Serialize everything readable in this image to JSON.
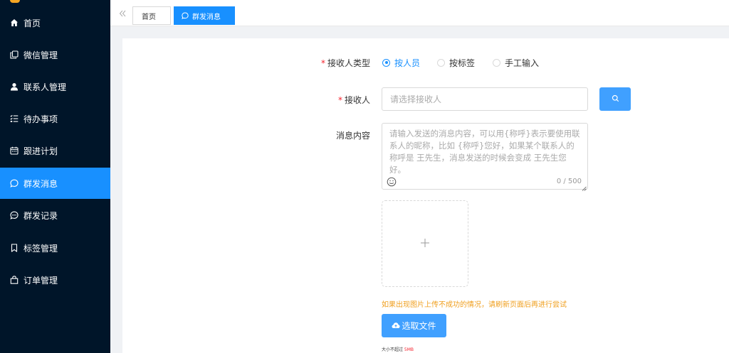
{
  "sidebar": {
    "items": [
      {
        "label": "首页",
        "icon": "home-icon"
      },
      {
        "label": "微信管理",
        "icon": "copy-icon"
      },
      {
        "label": "联系人管理",
        "icon": "user-icon"
      },
      {
        "label": "待办事项",
        "icon": "checklist-icon"
      },
      {
        "label": "跟进计划",
        "icon": "calendar-icon"
      },
      {
        "label": "群发消息",
        "icon": "chat-icon",
        "active": true
      },
      {
        "label": "群发记录",
        "icon": "chat-dots-icon"
      },
      {
        "label": "标签管理",
        "icon": "bookmark-icon"
      },
      {
        "label": "订单管理",
        "icon": "bag-icon"
      }
    ]
  },
  "tabs": {
    "home": "首页",
    "active": "群发消息"
  },
  "form": {
    "required_mark": "*",
    "receiver_type": {
      "label": "接收人类型",
      "options": [
        "按人员",
        "按标签",
        "手工输入"
      ],
      "selected": "按人员"
    },
    "receiver": {
      "label": "接收人",
      "placeholder": "请选择接收人",
      "value": ""
    },
    "message": {
      "label": "消息内容",
      "placeholder": "请输入发送的消息内容，可以用{称呼}表示要使用联系人的昵称，比如 {称呼}您好，如果某个联系人的称呼是 王先生，消息发送的时候会变成 王先生您好。",
      "value": "",
      "counter": "0 / 500"
    },
    "upload": {
      "warning": "如果出现图片上传不成功的情况，请刷新页面后再进行尝试",
      "file_button": "选取文件",
      "size_tip_prefix": "大小不超过 ",
      "size_limit": "5MB"
    }
  },
  "colors": {
    "sidebar_bg": "#001529",
    "primary": "#1890ff",
    "button_blue": "#40a0ff",
    "warning": "#f0a020",
    "required": "#f5222d"
  }
}
